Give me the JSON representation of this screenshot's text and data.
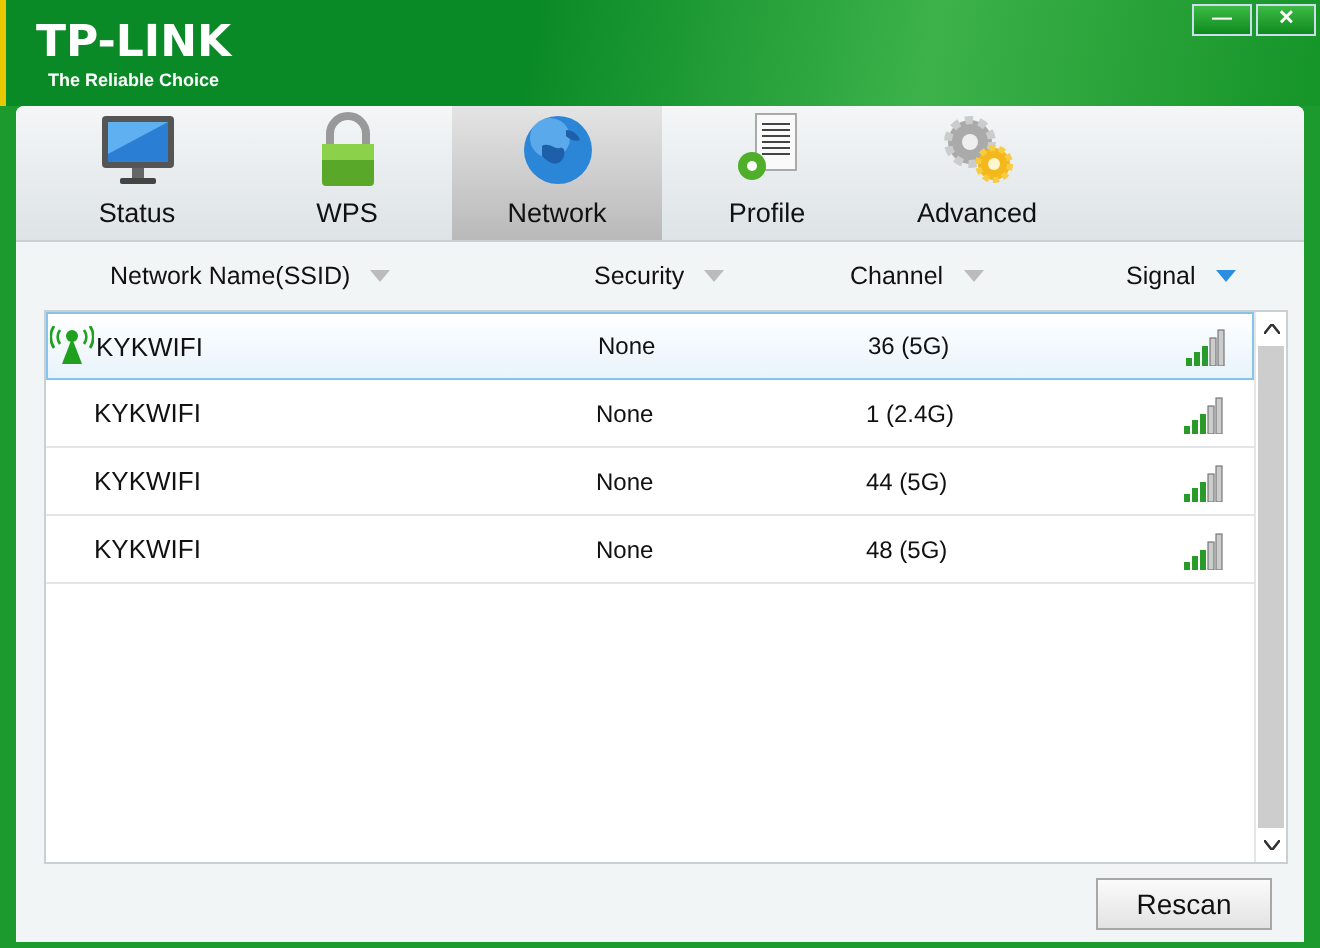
{
  "brand": {
    "logo": "TP-LINK",
    "tagline": "The Reliable Choice"
  },
  "window_buttons": [
    "—",
    "✕"
  ],
  "tabs": [
    {
      "label": "Status",
      "kind": "monitor",
      "selected": false
    },
    {
      "label": "WPS",
      "kind": "lock",
      "selected": false
    },
    {
      "label": "Network",
      "kind": "globe",
      "selected": true
    },
    {
      "label": "Profile",
      "kind": "document",
      "selected": false
    },
    {
      "label": "Advanced",
      "kind": "gears",
      "selected": false
    }
  ],
  "table": {
    "columns": [
      {
        "label": "Network Name(SSID)",
        "sorted": false
      },
      {
        "label": "Security",
        "sorted": false
      },
      {
        "label": "Channel",
        "sorted": false
      },
      {
        "label": "Signal",
        "sorted": true
      }
    ],
    "rows": [
      {
        "ssid": "KYKWIFI",
        "security": "None",
        "channel": "36 (5G)",
        "selected": true,
        "connected": true
      },
      {
        "ssid": "KYKWIFI",
        "security": "None",
        "channel": "1 (2.4G)",
        "selected": false,
        "connected": false
      },
      {
        "ssid": "KYKWIFI",
        "security": "None",
        "channel": "44 (5G)",
        "selected": false,
        "connected": false
      },
      {
        "ssid": "KYKWIFI",
        "security": "None",
        "channel": "48 (5G)",
        "selected": false,
        "connected": false
      }
    ]
  },
  "buttons": [
    "Rescan"
  ]
}
